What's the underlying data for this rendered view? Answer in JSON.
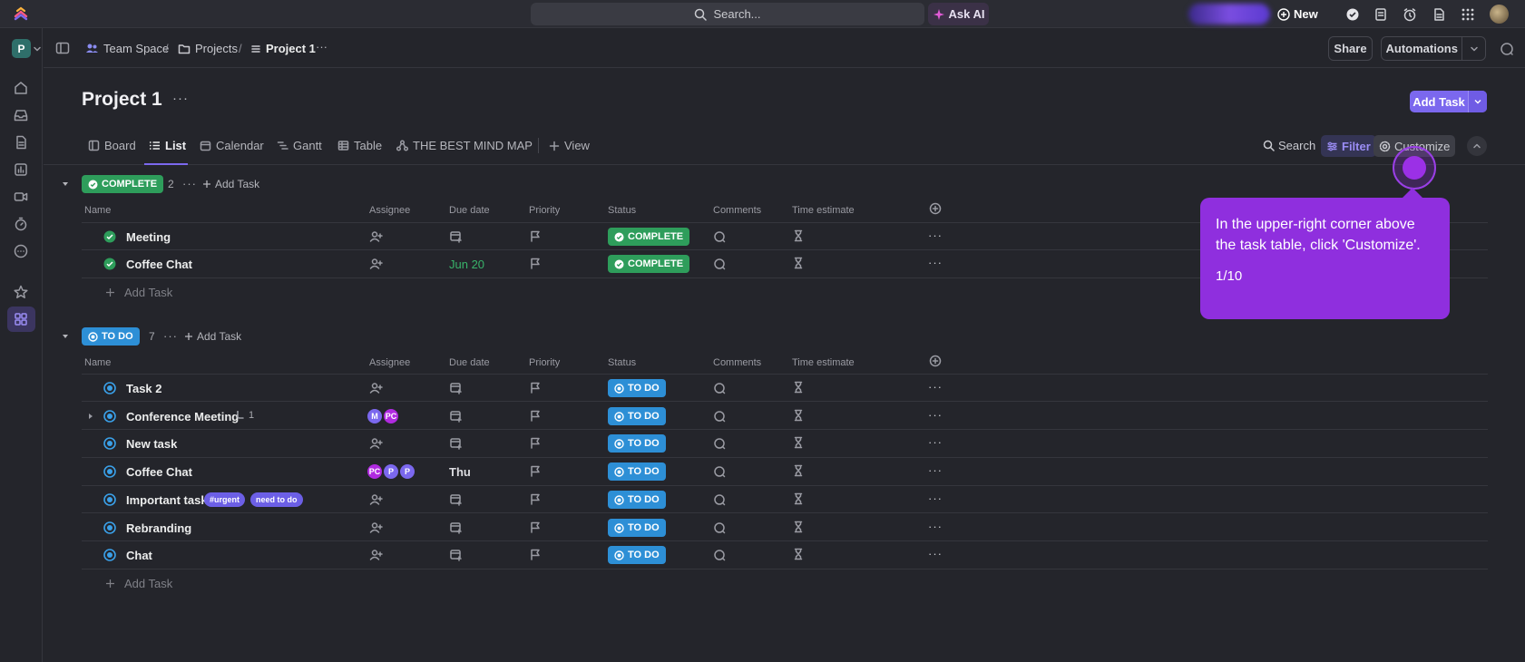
{
  "topbar": {
    "search_placeholder": "Search...",
    "ask_ai": "Ask AI",
    "new_label": "New"
  },
  "rail": {
    "workspace_initial": "P"
  },
  "breadcrumb": {
    "space": "Team Space",
    "folder": "Projects",
    "list": "Project 1",
    "sep": "/",
    "more": "···"
  },
  "header": {
    "share": "Share",
    "automations": "Automations",
    "title": "Project 1",
    "title_more": "···",
    "add_task": "Add Task"
  },
  "tabs": [
    {
      "label": "Board",
      "icon": "board-icon"
    },
    {
      "label": "List",
      "icon": "list-icon",
      "active": true
    },
    {
      "label": "Calendar",
      "icon": "calendar-icon"
    },
    {
      "label": "Gantt",
      "icon": "gantt-icon"
    },
    {
      "label": "Table",
      "icon": "table-icon"
    },
    {
      "label": "THE BEST MIND MAP",
      "icon": "mindmap-icon"
    },
    {
      "label": "View",
      "icon": "plus-icon"
    }
  ],
  "toolbar": {
    "search": "Search",
    "filter": "Filter",
    "customize": "Customize"
  },
  "columns": [
    "Name",
    "Assignee",
    "Due date",
    "Priority",
    "Status",
    "Comments",
    "Time estimate"
  ],
  "groups": [
    {
      "status": "COMPLETE",
      "count": "2",
      "add_task": "Add Task",
      "color": "#2e9d5b",
      "tasks": [
        {
          "name": "Meeting",
          "due": "",
          "status": "COMPLETE"
        },
        {
          "name": "Coffee Chat",
          "due": "Jun 20",
          "status": "COMPLETE"
        }
      ],
      "add_row": "Add Task"
    },
    {
      "status": "TO DO",
      "count": "7",
      "add_task": "Add Task",
      "color": "#2d8fd6",
      "tasks": [
        {
          "name": "Task 2",
          "status": "TO DO"
        },
        {
          "name": "Conference Meeting",
          "subtasks": "1",
          "assignees": [
            "M",
            "PC"
          ],
          "status": "TO DO"
        },
        {
          "name": "New task",
          "status": "TO DO"
        },
        {
          "name": "Coffee Chat",
          "due": "Thu",
          "assignees": [
            "PC",
            "P",
            "P"
          ],
          "status": "TO DO"
        },
        {
          "name": "Important task",
          "tags": [
            "#urgent",
            "need to do"
          ],
          "status": "TO DO"
        },
        {
          "name": "Rebranding",
          "status": "TO DO"
        },
        {
          "name": "Chat",
          "status": "TO DO"
        }
      ],
      "add_row": "Add Task"
    }
  ],
  "tooltip": {
    "text": "In the upper-right corner above the task table, click 'Customize'.",
    "step": "1/10"
  },
  "colors": {
    "accent": "#7b68ee",
    "tooltip": "#8f2fde",
    "complete": "#2e9d5b",
    "todo": "#2d8fd6"
  }
}
